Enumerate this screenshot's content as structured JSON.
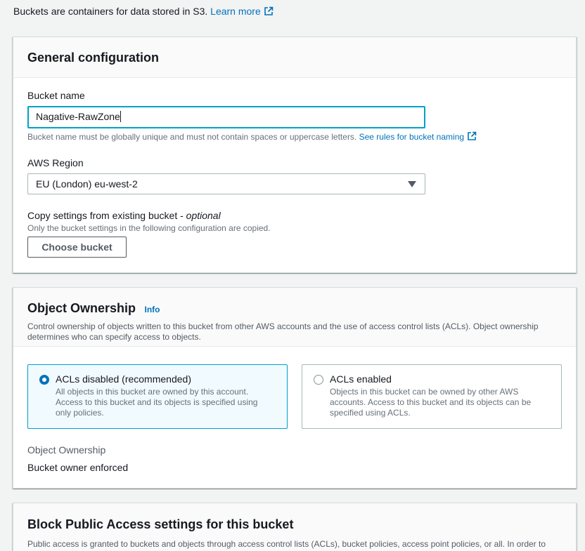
{
  "intro": {
    "text": "Buckets are containers for data stored in S3.",
    "learn_more": "Learn more"
  },
  "general": {
    "title": "General configuration",
    "bucket_name_label": "Bucket name",
    "bucket_name_value": "Nagative-RawZone",
    "bucket_name_hint": "Bucket name must be globally unique and must not contain spaces or uppercase letters.",
    "rules_link": "See rules for bucket naming",
    "region_label": "AWS Region",
    "region_value": "EU (London) eu-west-2",
    "copy_label": "Copy settings from existing bucket -",
    "copy_optional": "optional",
    "copy_hint": "Only the bucket settings in the following configuration are copied.",
    "choose_button": "Choose bucket"
  },
  "ownership": {
    "title": "Object Ownership",
    "info": "Info",
    "description": "Control ownership of objects written to this bucket from other AWS accounts and the use of access control lists (ACLs). Object ownership determines who can specify access to objects.",
    "options": [
      {
        "label": "ACLs disabled (recommended)",
        "description": "All objects in this bucket are owned by this account. Access to this bucket and its objects is specified using only policies.",
        "selected": true
      },
      {
        "label": "ACLs enabled",
        "description": "Objects in this bucket can be owned by other AWS accounts. Access to this bucket and its objects can be specified using ACLs.",
        "selected": false
      }
    ],
    "field_label": "Object Ownership",
    "field_value": "Bucket owner enforced"
  },
  "block_public": {
    "title": "Block Public Access settings for this bucket",
    "description": "Public access is granted to buckets and objects through access control lists (ACLs), bucket policies, access point policies, or all. In order to ensure that public access to this bucket and its objects is blocked, turn on Block all public access. These settings apply only to this bucket"
  },
  "colors": {
    "link": "#0073bb",
    "focus": "#00a1c9",
    "selected_bg": "#f1faff"
  }
}
